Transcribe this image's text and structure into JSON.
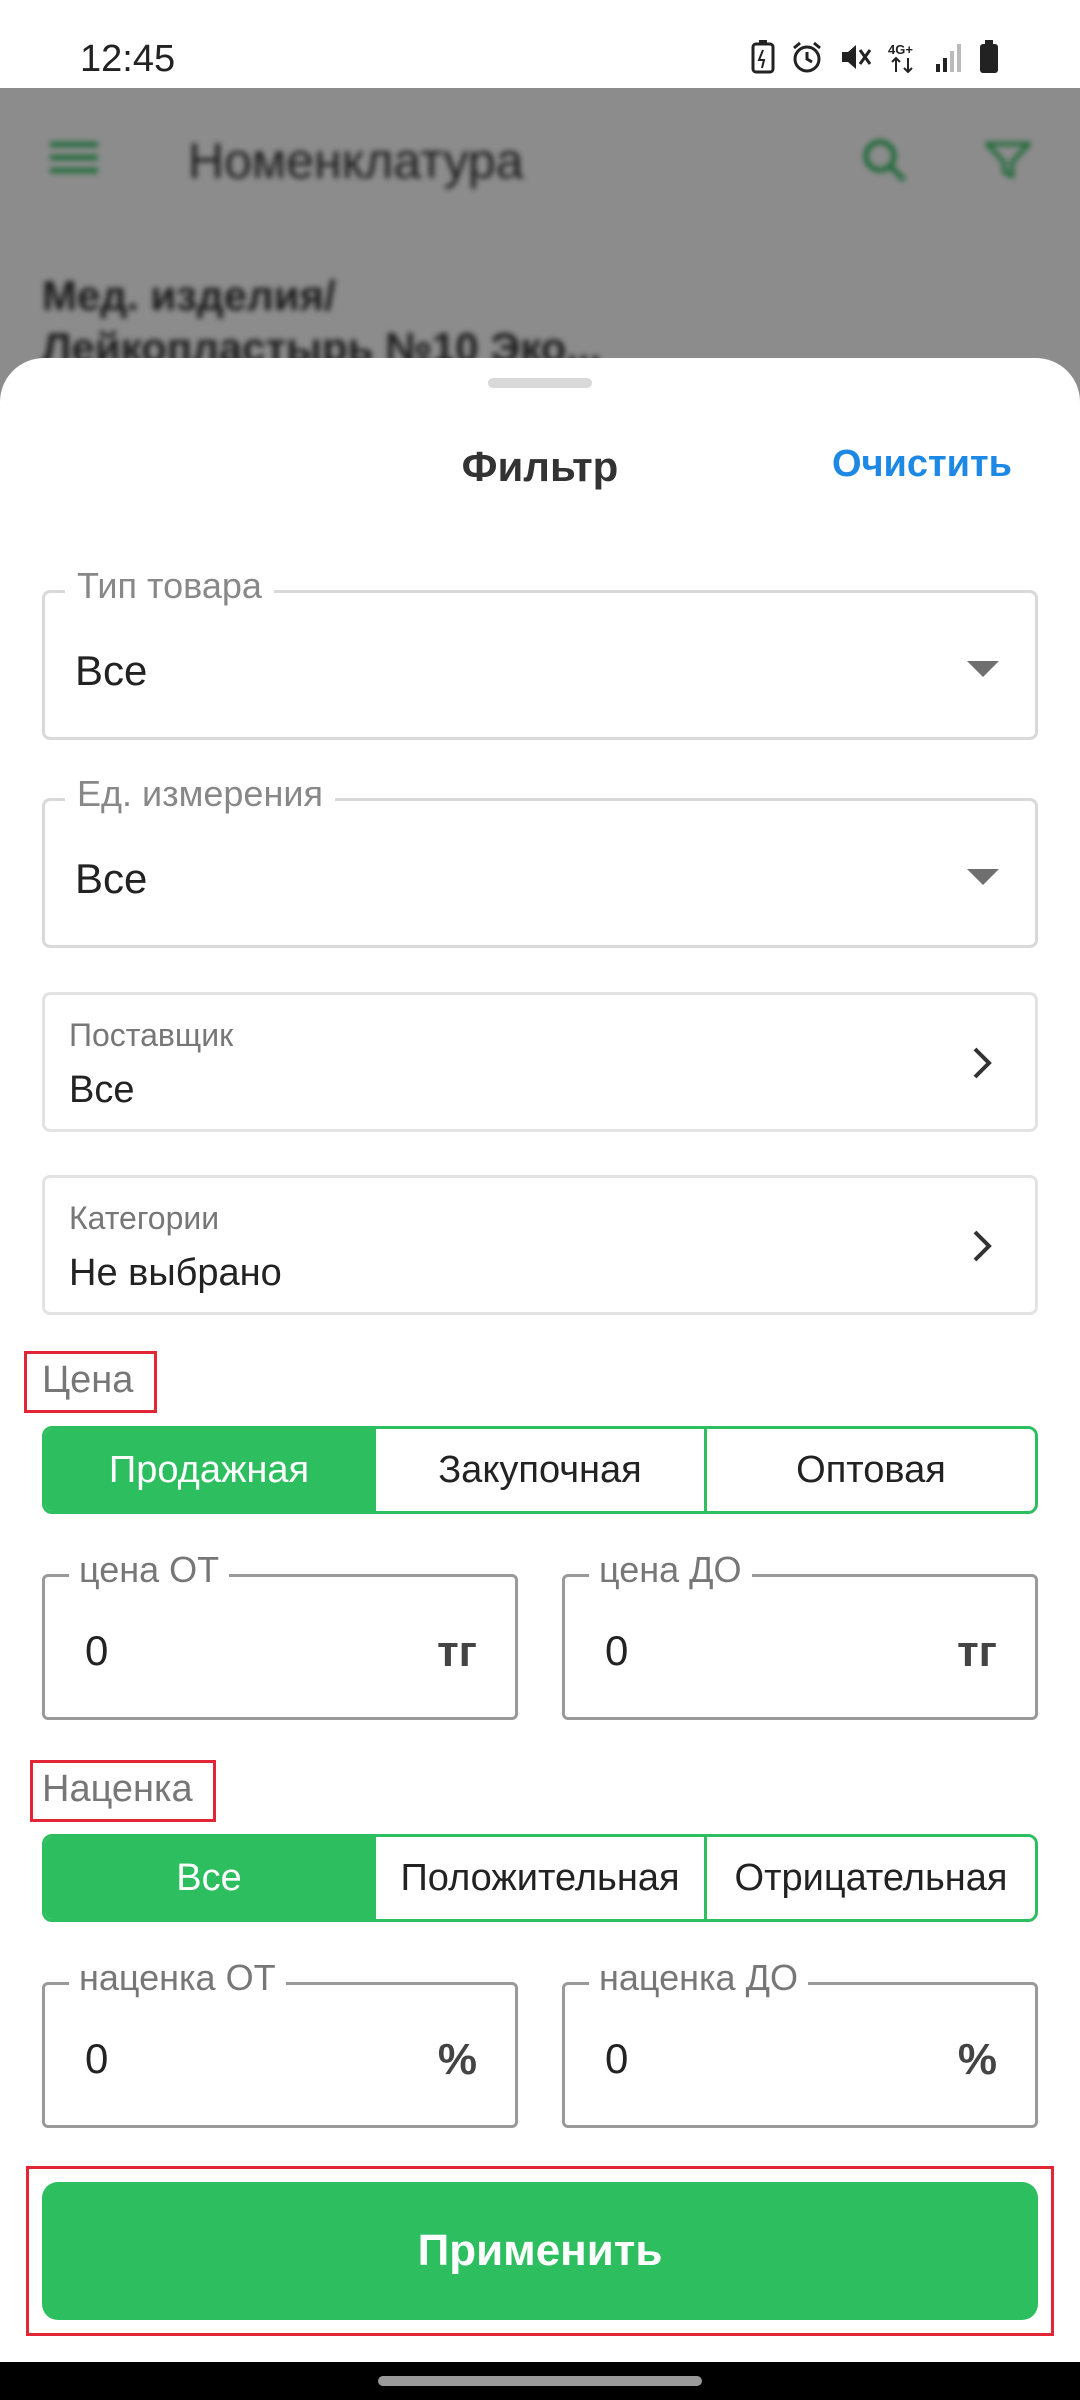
{
  "status_bar": {
    "time": "12:45"
  },
  "background_app": {
    "title": "Номенклатура",
    "item_text_line1": "Мед. изделия/",
    "item_text_line2": "Лейкопластырь №10 Эко..."
  },
  "filter": {
    "title": "Фильтр",
    "clear_label": "Очистить",
    "product_type": {
      "label": "Тип товара",
      "value": "Все"
    },
    "unit": {
      "label": "Ед. измерения",
      "value": "Все"
    },
    "supplier": {
      "label": "Поставщик",
      "value": "Все"
    },
    "categories": {
      "label": "Категории",
      "value": "Не выбрано"
    },
    "price": {
      "section_label": "Цена",
      "options": [
        "Продажная",
        "Закупочная",
        "Оптовая"
      ],
      "selected": "Продажная",
      "from": {
        "label": "цена ОТ",
        "value": "0",
        "unit": "тг"
      },
      "to": {
        "label": "цена ДО",
        "value": "0",
        "unit": "тг"
      }
    },
    "markup": {
      "section_label": "Наценка",
      "options": [
        "Все",
        "Положительная",
        "Отрицательная"
      ],
      "selected": "Все",
      "from": {
        "label": "наценка ОТ",
        "value": "0",
        "unit": "%"
      },
      "to": {
        "label": "наценка ДО",
        "value": "0",
        "unit": "%"
      }
    },
    "apply_label": "Применить"
  },
  "colors": {
    "accent_green": "#2dbe60",
    "link_blue": "#1e88e5",
    "highlight_red": "#e32636"
  },
  "icons": [
    "battery-saver-icon",
    "alarm-icon",
    "mute-icon",
    "4g-icon",
    "signal-icon",
    "battery-icon",
    "chevron-right-icon",
    "dropdown-arrow-icon"
  ]
}
